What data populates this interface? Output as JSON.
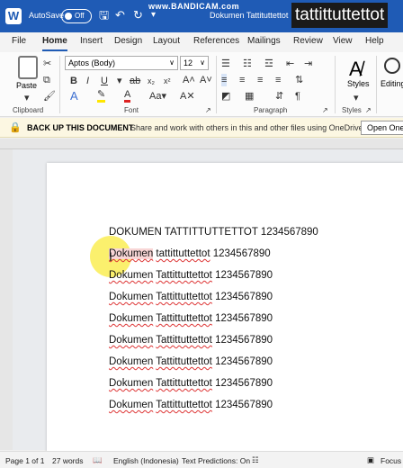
{
  "titlebar": {
    "logo": "W",
    "autosave_label": "AutoSave",
    "autosave_state": "Off",
    "watermark": "www.BANDICAM.com",
    "doc_title": "Dokumen Tattituttettot",
    "overlay_title": "tattittuttettot"
  },
  "tabs": [
    "File",
    "Home",
    "Insert",
    "Design",
    "Layout",
    "References",
    "Mailings",
    "Review",
    "View",
    "Help"
  ],
  "active_tab": "Home",
  "ribbon": {
    "paste_label": "Paste",
    "clipboard_label": "Clipboard",
    "font_name": "Aptos (Body)",
    "font_size": "12",
    "font_label": "Font",
    "paragraph_label": "Paragraph",
    "styles_label": "Styles",
    "styles_group_label": "Styles",
    "editing_label": "Editing"
  },
  "message_bar": {
    "title": "BACK UP THIS DOCUMENT",
    "text": "Share and work with others in this and other files using OneDrive.",
    "button": "Open One"
  },
  "document": {
    "heading": "DOKUMEN TATTITTUTTETTOT 1234567890",
    "line2": {
      "word1": "Dokumen",
      "word2": "tattittuttettot",
      "number": "1234567890"
    },
    "lines": [
      {
        "word1": "Dokumen",
        "word2": "Tattittuttettot",
        "number": "1234567890"
      },
      {
        "word1": "Dokumen",
        "word2": "Tattittuttettot",
        "number": "1234567890"
      },
      {
        "word1": "Dokumen",
        "word2": "Tattittuttettot",
        "number": "1234567890"
      },
      {
        "word1": "Dokumen",
        "word2": "Tattittuttettot",
        "number": "1234567890"
      },
      {
        "word1": "Dokumen",
        "word2": "Tattittuttettot",
        "number": "1234567890"
      },
      {
        "word1": "Dokumen",
        "word2": "Tattittuttettot",
        "number": "1234567890"
      },
      {
        "word1": "Dokumen",
        "word2": "Tattittuttettot",
        "number": "1234567890"
      }
    ]
  },
  "statusbar": {
    "page": "Page 1 of 1",
    "words": "27 words",
    "language": "English (Indonesia)",
    "predictions": "Text Predictions: On",
    "focus": "Focus"
  }
}
